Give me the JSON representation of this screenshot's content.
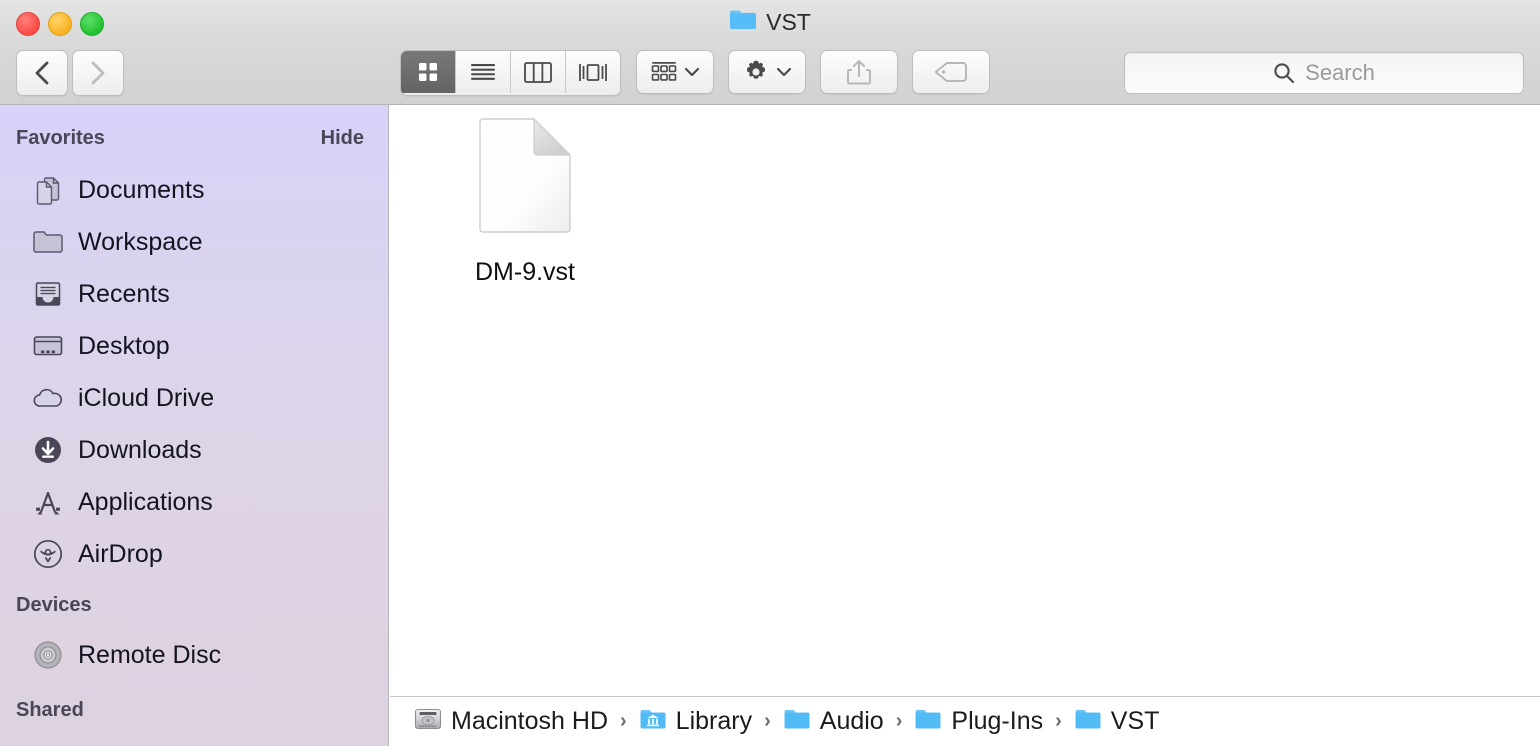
{
  "window": {
    "title": "VST",
    "title_icon": "folder-icon",
    "traffic_lights": [
      {
        "name": "close",
        "color": "#f94b44"
      },
      {
        "name": "minimize",
        "color": "#f9b121"
      },
      {
        "name": "maximize",
        "color": "#21c12f"
      }
    ]
  },
  "toolbar": {
    "back_label": "Back",
    "forward_label": "Forward",
    "view_modes": [
      {
        "name": "icon-view",
        "icon": "grid-icon",
        "active": true
      },
      {
        "name": "list-view",
        "icon": "list-icon",
        "active": false
      },
      {
        "name": "column-view",
        "icon": "columns-icon",
        "active": false
      },
      {
        "name": "gallery-view",
        "icon": "gallery-icon",
        "active": false
      }
    ],
    "arrange_label": "Arrange By",
    "arrange_icon": "arrange-grid-icon",
    "action_label": "Action",
    "action_icon": "gear-icon",
    "share_label": "Share",
    "share_icon": "share-icon",
    "tags_label": "Tags",
    "tags_icon": "tag-icon",
    "disabled_buttons": [
      "share",
      "tags",
      "forward"
    ]
  },
  "search": {
    "placeholder": "Search",
    "value": "",
    "icon": "search-icon"
  },
  "sidebar": {
    "sections": [
      {
        "title": "Favorites",
        "action_label": "Hide",
        "items": [
          {
            "label": "Documents",
            "icon": "documents-icon"
          },
          {
            "label": "Workspace",
            "icon": "folder-icon"
          },
          {
            "label": "Recents",
            "icon": "recents-tray-icon"
          },
          {
            "label": "Desktop",
            "icon": "desktop-icon"
          },
          {
            "label": "iCloud Drive",
            "icon": "cloud-icon"
          },
          {
            "label": "Downloads",
            "icon": "download-circle-icon"
          },
          {
            "label": "Applications",
            "icon": "applications-icon"
          },
          {
            "label": "AirDrop",
            "icon": "airdrop-icon"
          }
        ]
      },
      {
        "title": "Devices",
        "action_label": "",
        "items": [
          {
            "label": "Remote Disc",
            "icon": "optical-disc-icon"
          }
        ]
      },
      {
        "title": "Shared",
        "action_label": "",
        "items": []
      }
    ]
  },
  "content": {
    "files": [
      {
        "name": "DM-9.vst",
        "icon": "blank-document-icon",
        "selected": false
      }
    ]
  },
  "pathbar": {
    "crumbs": [
      {
        "label": "Macintosh HD",
        "icon": "hard-disk-icon"
      },
      {
        "label": "Library",
        "icon": "library-folder-icon"
      },
      {
        "label": "Audio",
        "icon": "folder-icon"
      },
      {
        "label": "Plug-Ins",
        "icon": "folder-icon"
      },
      {
        "label": "VST",
        "icon": "folder-icon"
      }
    ],
    "separator": "›"
  },
  "colors": {
    "folder_blue": "#5cc0f5",
    "sidebar_top": "#d9d2f9",
    "sidebar_bottom": "#ddd2e0",
    "toolbar": "#d8d8d8"
  }
}
